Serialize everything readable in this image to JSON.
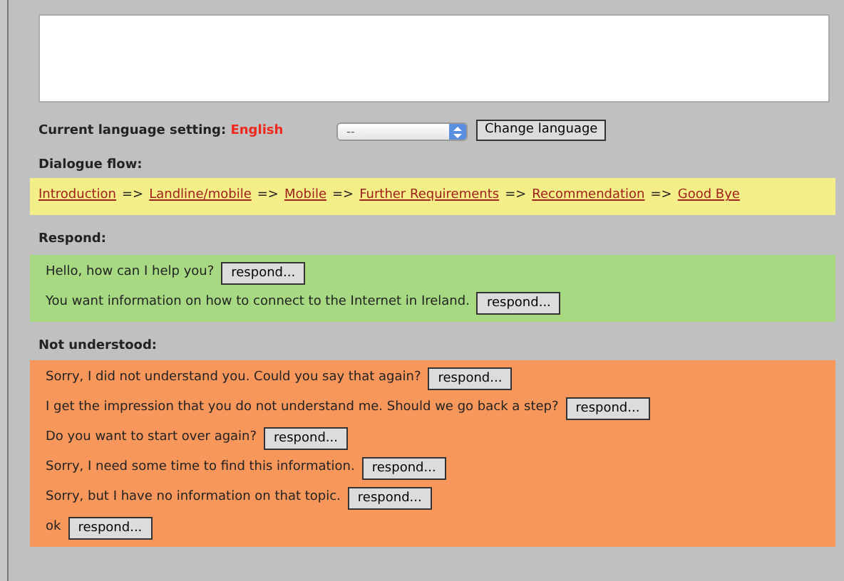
{
  "language": {
    "label": "Current language setting:",
    "value": "English",
    "select": {
      "value": "--"
    },
    "button": "Change language"
  },
  "flow": {
    "label": "Dialogue flow:",
    "separator": "=>",
    "steps": [
      "Introduction",
      "Landline/mobile",
      "Mobile",
      "Further Requirements",
      "Recommendation",
      "Good Bye"
    ]
  },
  "sections": [
    {
      "kind": "respond",
      "label": "Respond:",
      "rows": [
        {
          "text": "Hello, how can I help you?",
          "button": "respond..."
        },
        {
          "text": "You want information on how to connect to the Internet in Ireland.",
          "button": "respond..."
        }
      ]
    },
    {
      "kind": "not_understood",
      "label": "Not understood:",
      "rows": [
        {
          "text": "Sorry, I did not understand you. Could you say that again?",
          "button": "respond..."
        },
        {
          "text": "I get the impression that you do not understand me. Should we go back a step?",
          "button": "respond..."
        },
        {
          "text": "Do you want to start over again?",
          "button": "respond..."
        },
        {
          "text": "Sorry, I need some time to find this information.",
          "button": "respond..."
        },
        {
          "text": "Sorry, but I have no information on that topic.",
          "button": "respond..."
        },
        {
          "text": "ok",
          "button": "respond..."
        }
      ]
    }
  ]
}
